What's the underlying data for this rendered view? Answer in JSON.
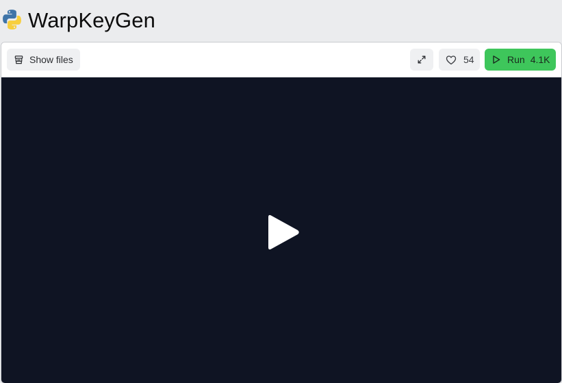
{
  "header": {
    "title": "WarpKeyGen",
    "logo_icon": "python-logo-icon"
  },
  "toolbar": {
    "show_files_label": "Show files",
    "like_count": "54",
    "run_label": "Run",
    "run_count": "4.1K",
    "icons": {
      "show_files": "files-stack-icon",
      "expand": "expand-icon",
      "like": "heart-icon",
      "run": "play-outline-icon"
    }
  },
  "stage": {
    "play_icon": "play-icon"
  },
  "colors": {
    "page_bg": "#ebecee",
    "stage_bg": "#0f1423",
    "run_accent": "#3ec65b",
    "button_bg": "#eff0f2"
  }
}
